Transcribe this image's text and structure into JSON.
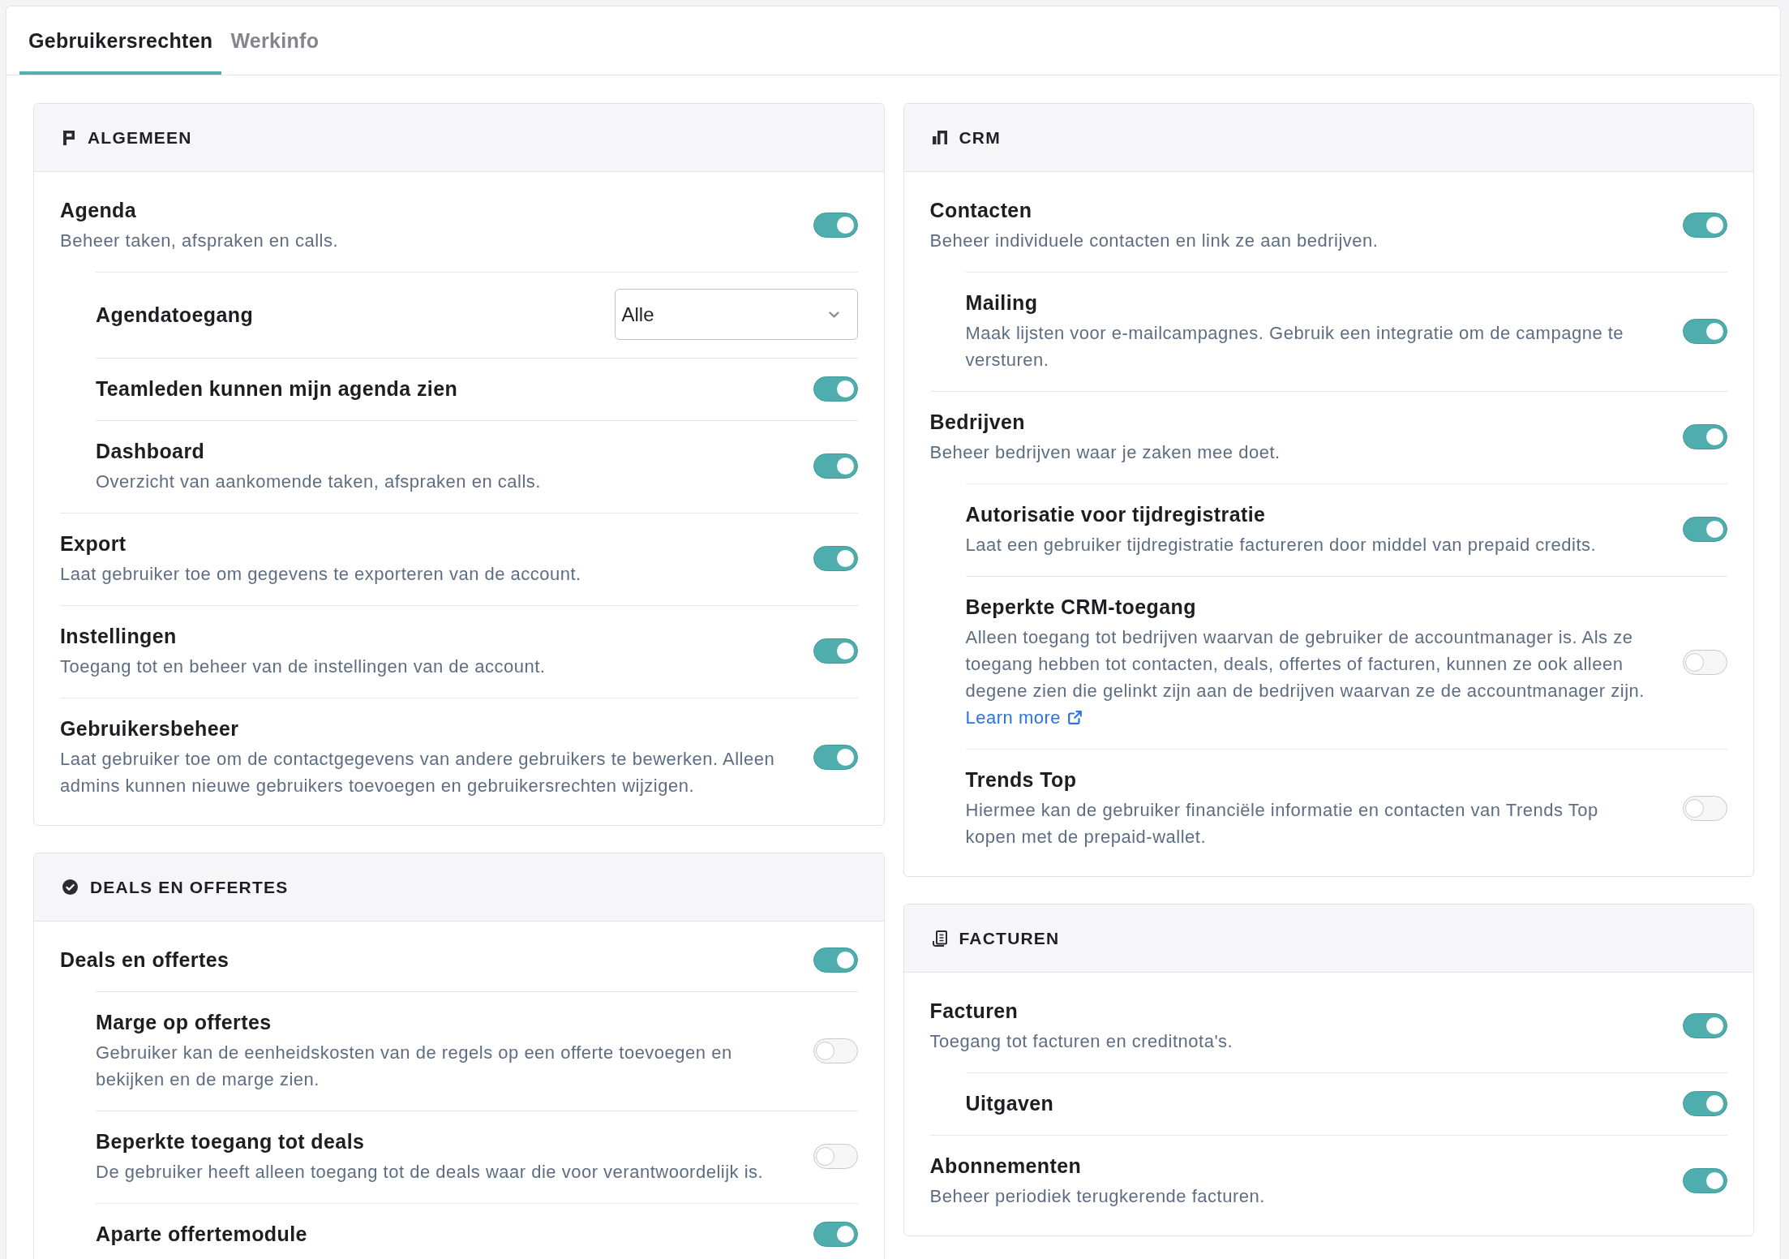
{
  "tabs": [
    {
      "label": "Gebruikersrechten",
      "selected": true
    },
    {
      "label": "Werkinfo",
      "selected": false
    }
  ],
  "columns": [
    {
      "sections": [
        {
          "title": "ALGEMEEN",
          "rows": [
            {
              "kind": "toggle",
              "title": "Agenda",
              "description": "Beheer taken, afspraken en calls.",
              "on": true,
              "children": [
                {
                  "kind": "select",
                  "title": "Agendatoegang",
                  "value": "Alle"
                },
                {
                  "kind": "toggle",
                  "title": "Teamleden kunnen mijn agenda zien",
                  "on": true
                },
                {
                  "kind": "toggle",
                  "title": "Dashboard",
                  "description": "Overzicht van aankomende taken, afspraken en calls.",
                  "on": true
                }
              ]
            },
            {
              "kind": "toggle",
              "title": "Export",
              "description": "Laat gebruiker toe om gegevens te exporteren van de account.",
              "on": true
            },
            {
              "kind": "toggle",
              "title": "Instellingen",
              "description": "Toegang tot en beheer van de instellingen van de account.",
              "on": true
            },
            {
              "kind": "toggle",
              "title": "Gebruikersbeheer",
              "description": "Laat gebruiker toe om de contactgegevens van andere gebruikers te bewerken. Alleen admins kunnen nieuwe gebruikers toevoegen en gebruikersrechten wijzigen.",
              "on": true
            }
          ]
        },
        {
          "title": "DEALS EN OFFERTES",
          "rows": [
            {
              "kind": "toggle",
              "title": "Deals en offertes",
              "on": true,
              "children": [
                {
                  "kind": "toggle",
                  "title": "Marge op offertes",
                  "description": "Gebruiker kan de eenheidskosten van de regels op een offerte toevoegen en bekijken en de marge zien.",
                  "on": false
                },
                {
                  "kind": "toggle",
                  "title": "Beperkte toegang tot deals",
                  "description": "De gebruiker heeft alleen toegang tot de deals waar die voor verantwoordelijk is.",
                  "on": false
                },
                {
                  "kind": "toggle",
                  "title": "Aparte offertemodule",
                  "on": true
                }
              ]
            }
          ]
        }
      ]
    },
    {
      "sections": [
        {
          "title": "CRM",
          "rows": [
            {
              "kind": "toggle",
              "title": "Contacten",
              "description": "Beheer individuele contacten en link ze aan bedrijven.",
              "on": true,
              "children": [
                {
                  "kind": "toggle",
                  "title": "Mailing",
                  "description": "Maak lijsten voor e-mailcampagnes. Gebruik een integratie om de campagne te versturen.",
                  "on": true
                }
              ]
            },
            {
              "kind": "toggle",
              "title": "Bedrijven",
              "description": "Beheer bedrijven waar je zaken mee doet.",
              "on": true,
              "children": [
                {
                  "kind": "toggle",
                  "title": "Autorisatie voor tijdregistratie",
                  "description": "Laat een gebruiker tijdregistratie factureren door middel van prepaid credits.",
                  "on": true
                },
                {
                  "kind": "toggle",
                  "title": "Beperkte CRM-toegang",
                  "description": "Alleen toegang tot bedrijven waarvan de gebruiker de accountmanager is. Als ze toegang hebben tot contacten, deals, offertes of facturen, kunnen ze ook alleen degene zien die gelinkt zijn aan de bedrijven waarvan ze de accountmanager zijn.",
                  "link": "Learn more",
                  "on": false
                },
                {
                  "kind": "toggle",
                  "title": "Trends Top",
                  "description": "Hiermee kan de gebruiker financiële informatie en contacten van Trends Top kopen met de prepaid-wallet.",
                  "on": false
                }
              ]
            }
          ]
        },
        {
          "title": "FACTUREN",
          "rows": [
            {
              "kind": "toggle",
              "title": "Facturen",
              "description": "Toegang tot facturen en creditnota's.",
              "on": true,
              "children": [
                {
                  "kind": "toggle",
                  "title": "Uitgaven",
                  "on": true
                }
              ]
            },
            {
              "kind": "toggle",
              "title": "Abonnementen",
              "description": "Beheer periodiek terugkerende facturen.",
              "on": true
            }
          ]
        }
      ]
    }
  ]
}
